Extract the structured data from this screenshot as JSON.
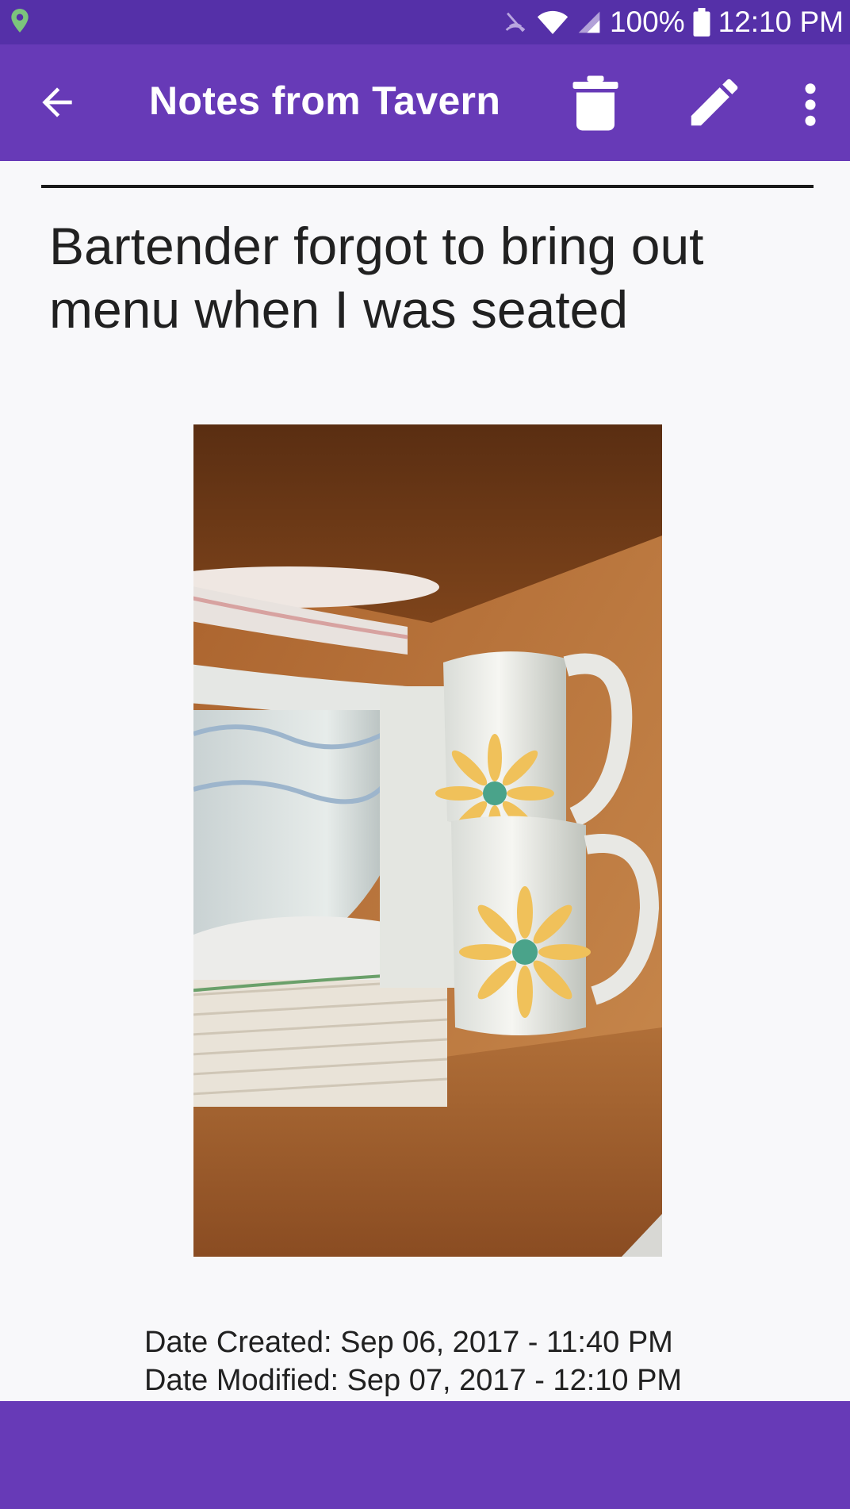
{
  "status_bar": {
    "battery": "100%",
    "time": "12:10 PM",
    "icons": [
      "location-icon",
      "hotspot-icon",
      "wifi-icon",
      "cellular-signal-icon",
      "battery-icon"
    ]
  },
  "app_bar": {
    "title": "Notes from Tavern",
    "icons": [
      "back-arrow-icon",
      "trash-icon",
      "pencil-icon",
      "more-vert-icon"
    ]
  },
  "note": {
    "title": "Bartender forgot to bring out menu when I was seated",
    "photo_subject": "Dishes and sunflower mugs in a wooden cupboard",
    "date_created": "Date Created: Sep 06, 2017 - 11:40 PM",
    "date_modified": "Date Modified: Sep 07, 2017 - 12:10 PM"
  },
  "colors": {
    "status_bar": "#5530A8",
    "app_bar": "#673AB7",
    "bottom_bar": "#673AB7",
    "background": "#F8F8FA",
    "location_pin": "#7CC47C"
  }
}
